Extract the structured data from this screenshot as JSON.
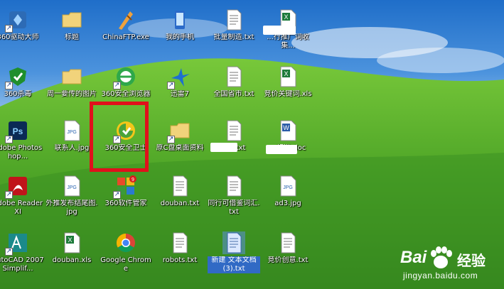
{
  "desktop": {
    "icons": [
      {
        "label": "360驱动大师",
        "icon": "360-driver-icon"
      },
      {
        "label": "标题",
        "icon": "folder-icon"
      },
      {
        "label": "ChinaFTP.exe",
        "icon": "chinaftp-icon"
      },
      {
        "label": "我的手机",
        "icon": "phone-icon"
      },
      {
        "label": "批量制造.txt",
        "icon": "text-file-icon"
      },
      {
        "label": "...行推广词收集...",
        "icon": "excel-file-icon"
      },
      {
        "label": "360杀毒",
        "icon": "360-antivirus-icon"
      },
      {
        "label": "周一要传的图片",
        "icon": "folder-icon"
      },
      {
        "label": "360安全浏览器",
        "icon": "360-browser-icon"
      },
      {
        "label": "迅雷7",
        "icon": "thunder-icon"
      },
      {
        "label": "全国省市.txt",
        "icon": "text-file-icon"
      },
      {
        "label": "竞价关键词.xls",
        "icon": "excel-file-icon"
      },
      {
        "label": "Adobe Photoshop...",
        "icon": "photoshop-icon"
      },
      {
        "label": "联系人.jpg",
        "icon": "jpg-file-icon"
      },
      {
        "label": "360安全卫士",
        "icon": "360-safeguard-icon"
      },
      {
        "label": "原C盘桌面资料",
        "icon": "folder-icon"
      },
      {
        "label": "...8.txt",
        "icon": "text-file-icon"
      },
      {
        "label": "...标准.doc",
        "icon": "word-file-icon"
      },
      {
        "label": "Adobe Reader XI",
        "icon": "adobe-reader-icon"
      },
      {
        "label": "外推发布结尾图.jpg",
        "icon": "jpg-file-icon"
      },
      {
        "label": "360软件管家",
        "icon": "360-software-manager-icon"
      },
      {
        "label": "douban.txt",
        "icon": "text-file-icon"
      },
      {
        "label": "同行可借鉴词汇.txt",
        "icon": "text-file-icon"
      },
      {
        "label": "ad3.jpg",
        "icon": "jpg-file-icon"
      },
      {
        "label": "AutoCAD 2007 Simplif...",
        "icon": "autocad-icon"
      },
      {
        "label": "douban.xls",
        "icon": "excel-file-icon"
      },
      {
        "label": "Google Chrome",
        "icon": "chrome-icon"
      },
      {
        "label": "robots.txt",
        "icon": "text-file-icon"
      },
      {
        "label": "新建 文本文档 (3).txt",
        "icon": "text-file-icon",
        "selected": true
      },
      {
        "label": "竞价创意.txt",
        "icon": "text-file-icon"
      }
    ]
  },
  "watermark": {
    "bai": "Bai",
    "du": "经验",
    "url": "jingyan.baidu.com"
  },
  "colors": {
    "highlight": "#e0101b",
    "selected": "#316ac5"
  }
}
